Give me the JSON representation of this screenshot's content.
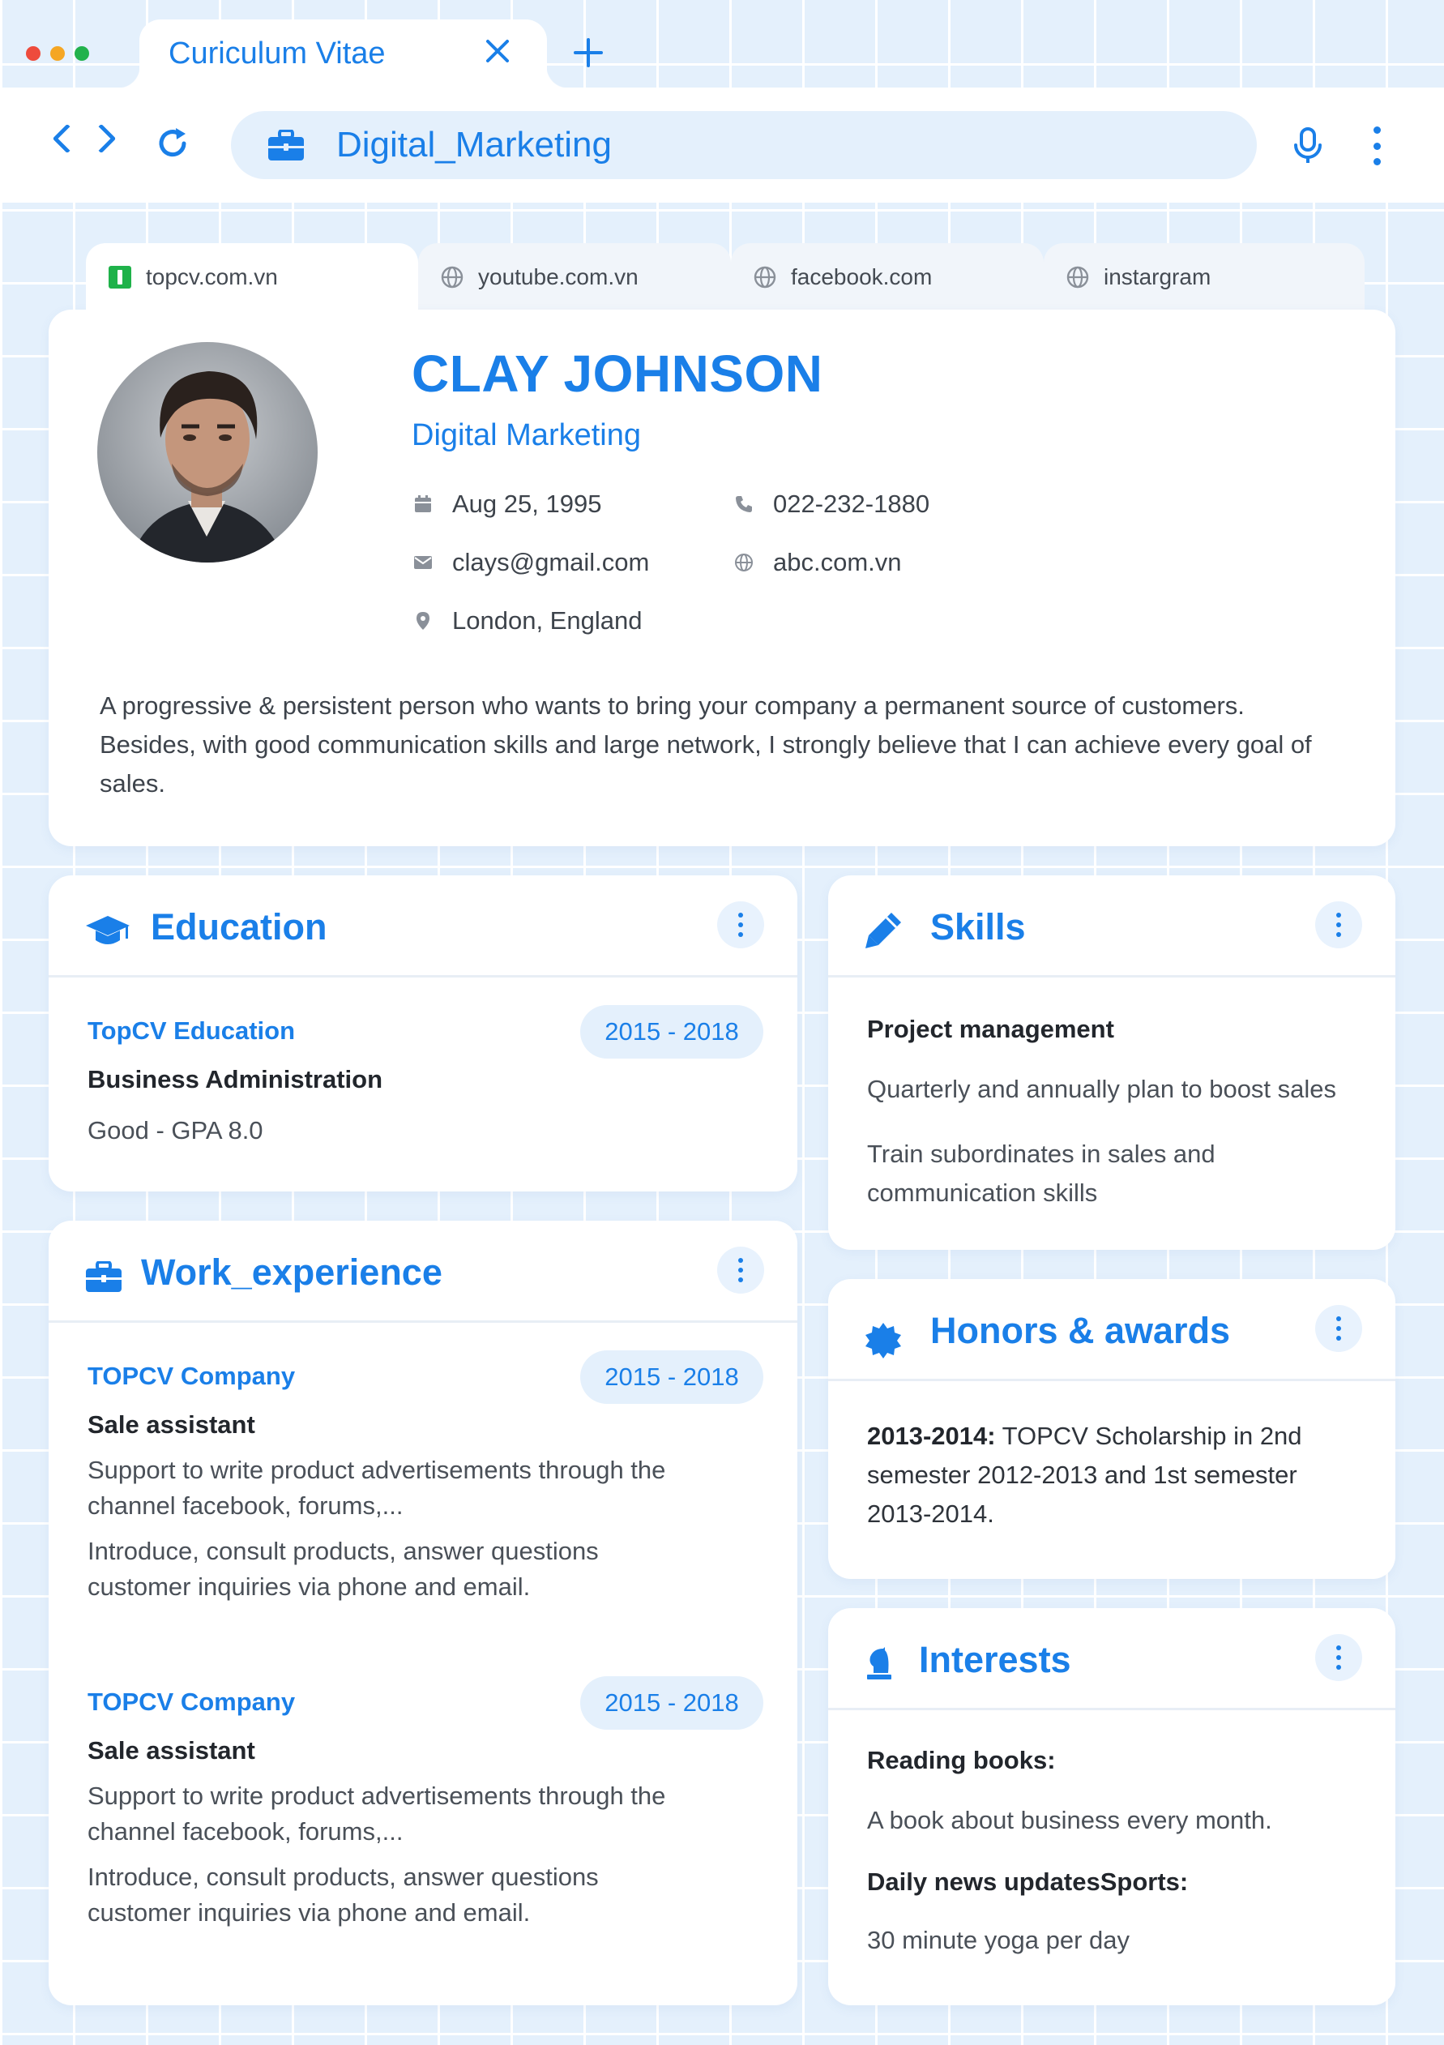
{
  "browser": {
    "tab_title": "Curiculum Vitae",
    "address": "Digital_Marketing",
    "window_dots": [
      "#ee4b3c",
      "#f5a623",
      "#22b24c"
    ]
  },
  "site_tabs": [
    {
      "label": "topcv.com.vn",
      "icon": "topcv-logo-icon"
    },
    {
      "label": "youtube.com.vn",
      "icon": "globe-icon"
    },
    {
      "label": "facebook.com",
      "icon": "globe-icon"
    },
    {
      "label": "instargram",
      "icon": "globe-icon"
    }
  ],
  "profile": {
    "name": "CLAY JOHNSON",
    "title": "Digital Marketing",
    "birthday": "Aug 25, 1995",
    "phone": "022-232-1880",
    "email": "clays@gmail.com",
    "website": "abc.com.vn",
    "location": "London, England",
    "bio": "A progressive & persistent person who wants to bring your company a permanent source of customers. Besides, with good communication skills and large network, I strongly believe that I can achieve every goal of sales."
  },
  "education": {
    "title": "Education",
    "school": "TopCV Education",
    "period": "2015 - 2018",
    "major": "Business Administration",
    "grade": "Good - GPA 8.0"
  },
  "work": {
    "title": "Work_experience",
    "jobs": [
      {
        "company": "TOPCV Company",
        "period": "2015 - 2018",
        "position": "Sale assistant",
        "duty1": "Support to write product advertisements through the channel facebook, forums,...",
        "duty2": "Introduce, consult products, answer questions customer inquiries via phone and email."
      },
      {
        "company": "TOPCV Company",
        "period": "2015 - 2018",
        "position": "Sale assistant",
        "duty1": "Support to write product advertisements through the channel facebook, forums,...",
        "duty2": "Introduce, consult products, answer questions customer inquiries via phone and email."
      }
    ]
  },
  "skills": {
    "title": "Skills",
    "heading": "Project management",
    "item1": "Quarterly and annually plan to boost sales",
    "item2": "Train subordinates in sales and communication skills"
  },
  "honors": {
    "title": "Honors & awards",
    "year": "2013-2014:",
    "text": "TOPCV Scholarship in 2nd semester 2012-2013 and 1st semester 2013-2014."
  },
  "interests": {
    "title": "Interests",
    "heading1": "Reading books:",
    "text1": "A book about business every month.",
    "heading2": "Daily news updatesSports:",
    "text2": "30 minute yoga per day"
  },
  "colors": {
    "accent": "#1a7fe8",
    "background": "#e4f0fc",
    "card": "#ffffff"
  }
}
